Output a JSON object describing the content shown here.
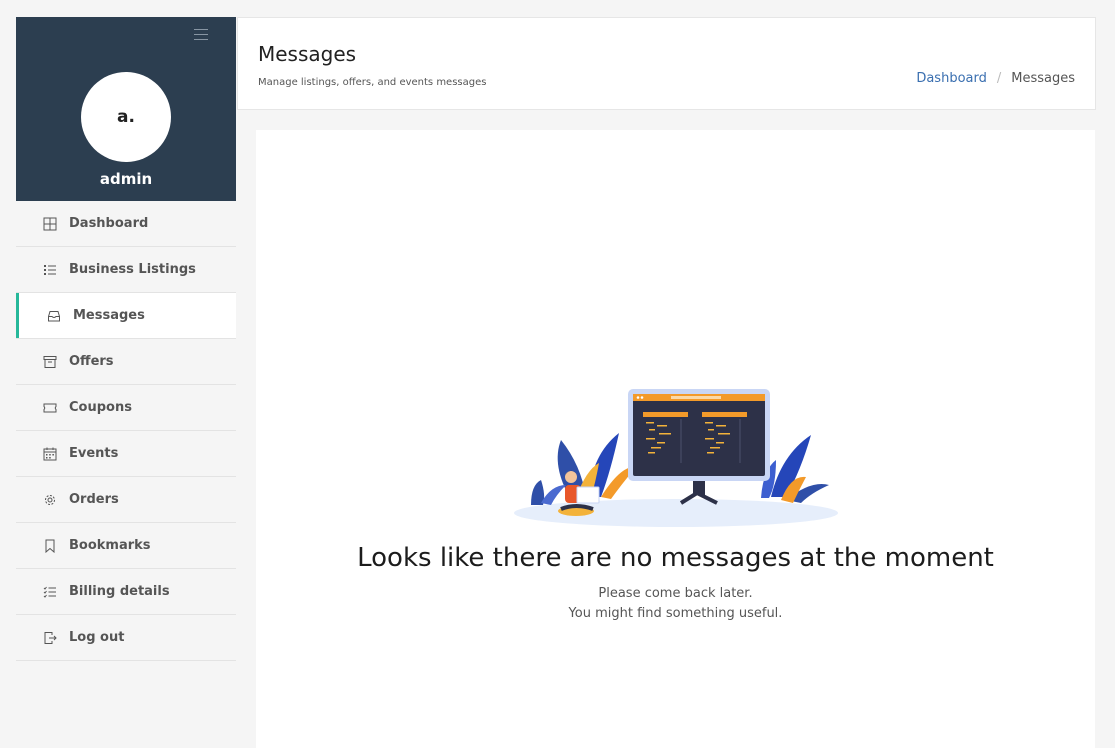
{
  "sidebar": {
    "avatar_initials": "a.",
    "username": "admin",
    "items": [
      {
        "label": "Dashboard",
        "icon": "grid-icon"
      },
      {
        "label": "Business Listings",
        "icon": "list-icon"
      },
      {
        "label": "Messages",
        "icon": "inbox-icon",
        "active": true
      },
      {
        "label": "Offers",
        "icon": "archive-icon"
      },
      {
        "label": "Coupons",
        "icon": "ticket-icon"
      },
      {
        "label": "Events",
        "icon": "calendar-icon"
      },
      {
        "label": "Orders",
        "icon": "gear-icon"
      },
      {
        "label": "Bookmarks",
        "icon": "bookmark-icon"
      },
      {
        "label": "Billing details",
        "icon": "checklist-icon"
      },
      {
        "label": "Log out",
        "icon": "logout-icon"
      }
    ]
  },
  "header": {
    "title": "Messages",
    "subtitle": "Manage listings, offers, and events messages",
    "breadcrumb": {
      "link": "Dashboard",
      "separator": "/",
      "current": "Messages"
    }
  },
  "empty_state": {
    "title": "Looks like there are no messages at the moment",
    "line1": "Please come back later.",
    "line2": "You might find something useful."
  },
  "colors": {
    "sidebar_profile_bg": "#2c3e50",
    "active_accent": "#26b89a",
    "link": "#3a6fb0"
  }
}
